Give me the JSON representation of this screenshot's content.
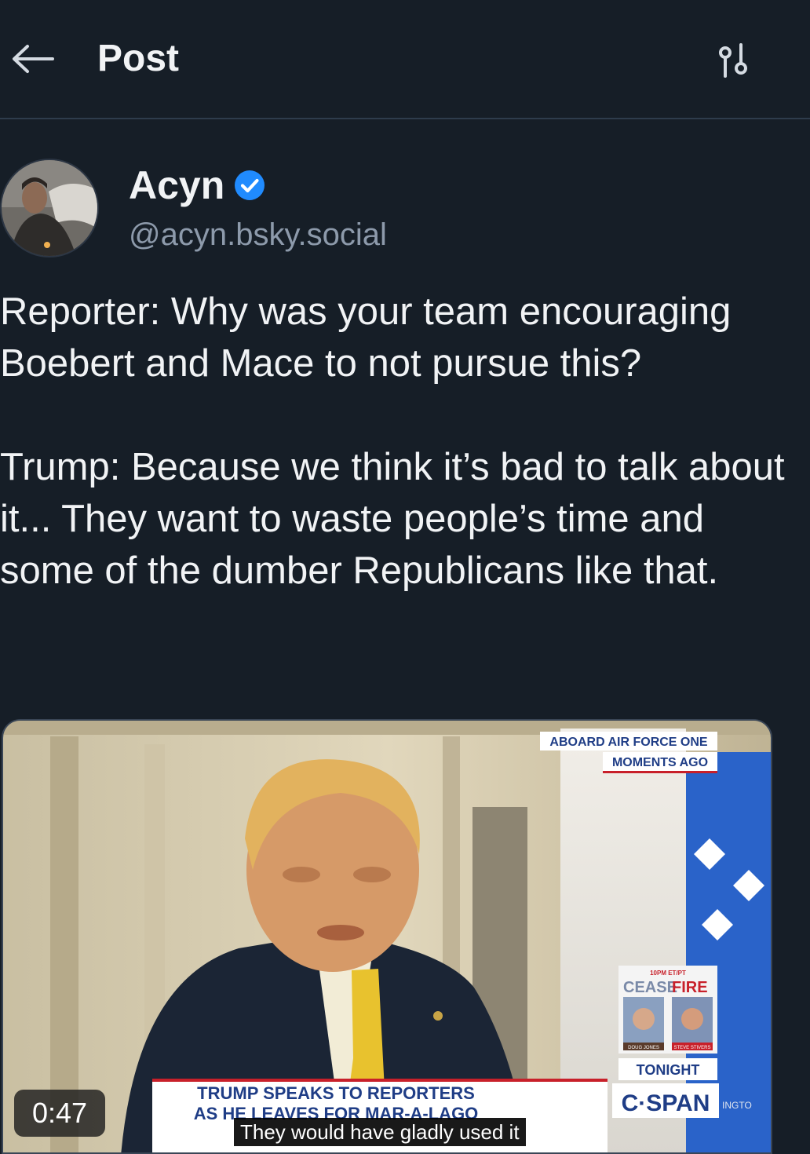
{
  "header": {
    "title": "Post"
  },
  "author": {
    "display_name": "Acyn",
    "handle": "@acyn.bsky.social"
  },
  "post": {
    "paragraph_1": "Reporter: Why was your team encouraging Boebert and Mace to not pursue this?",
    "paragraph_2": "Trump: Because we think it’s bad to talk about it... They want to waste people’s time and some of the dumber Republicans like that."
  },
  "video": {
    "duration": "0:47",
    "caption": "They would have gladly used it",
    "bug_line_1": "ABOARD AIR FORCE ONE",
    "bug_line_2": "MOMENTS AGO",
    "chyron_line_1": "TRUMP SPEAKS TO REPORTERS",
    "chyron_line_2": "AS HE LEAVES FOR MAR-A-LAGO",
    "promo_time": "10PM ET/PT",
    "promo_cease": "CEASE",
    "promo_fire": "FIRE",
    "promo_name_left": "DOUG JONES",
    "promo_name_right": "STEVE STIVERS",
    "promo_tonight": "TONIGHT",
    "network": "C·SPAN",
    "side_text": "INGTO"
  },
  "colors": {
    "background": "#161e27",
    "divider": "#2e3c4c",
    "text_primary": "#f1f3f5",
    "text_secondary": "#8d9aab",
    "verified_blue": "#208bfe",
    "chyron_blue": "#1f3d86",
    "chyron_red": "#c8202a"
  }
}
